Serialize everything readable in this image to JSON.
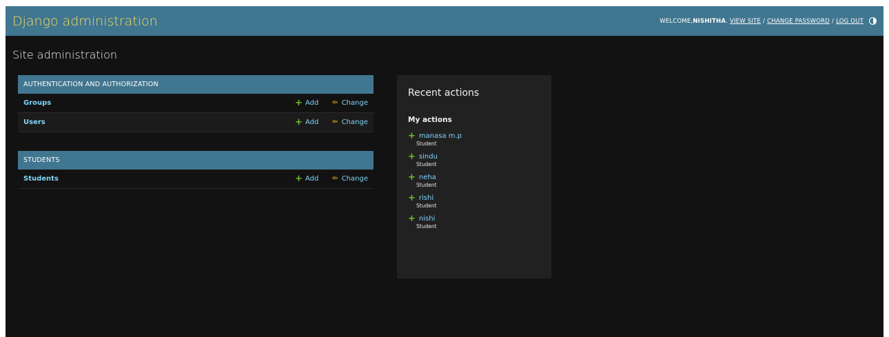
{
  "header": {
    "brand": "Django administration",
    "welcome_prefix": "WELCOME, ",
    "username": "NISHITHA",
    "welcome_suffix": ".",
    "view_site": "VIEW SITE",
    "change_password": "CHANGE PASSWORD",
    "log_out": "LOG OUT",
    "separator": "/"
  },
  "page_title": "Site administration",
  "modules": [
    {
      "caption": "AUTHENTICATION AND AUTHORIZATION",
      "models": [
        {
          "name": "Groups",
          "add": "Add",
          "change": "Change"
        },
        {
          "name": "Users",
          "add": "Add",
          "change": "Change"
        }
      ]
    },
    {
      "caption": "STUDENTS",
      "models": [
        {
          "name": "Students",
          "add": "Add",
          "change": "Change"
        }
      ]
    }
  ],
  "recent_actions": {
    "title": "Recent actions",
    "subtitle": "My actions",
    "items": [
      {
        "name": "manasa m.p",
        "type": "Student"
      },
      {
        "name": "sindu",
        "type": "Student"
      },
      {
        "name": "neha",
        "type": "Student"
      },
      {
        "name": "rishi",
        "type": "Student"
      },
      {
        "name": "nishi",
        "type": "Student"
      }
    ]
  },
  "colors": {
    "header_bg": "#417690",
    "brand": "#f5dd5d",
    "link": "#81d4fa",
    "add_icon": "#70bf2b",
    "change_icon": "#efb80b",
    "page_bg": "#121212"
  },
  "icons": {
    "add": "plus-icon",
    "change": "pencil-icon",
    "theme": "theme-toggle-icon"
  }
}
